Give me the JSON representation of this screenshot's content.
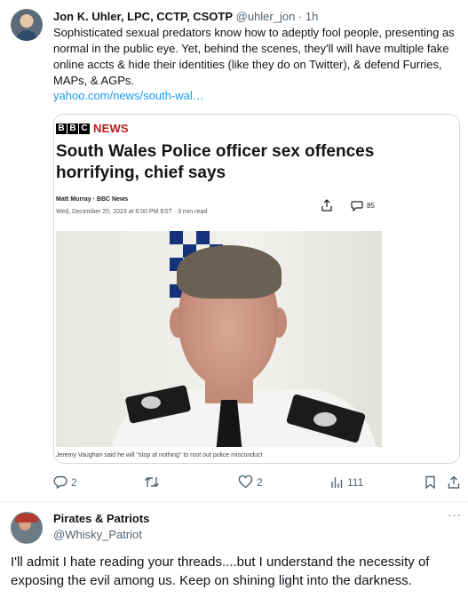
{
  "tweet1": {
    "author_name": "Jon K. Uhler, LPC, CCTP, CSOTP",
    "handle": "@uhler_jon",
    "separator": "·",
    "time": "1h",
    "text": "Sophisticated sexual predators know how to adeptly fool people, presenting as normal in the public eye. Yet, behind the scenes, they'll will have multiple fake online accts & hide their identities (like they do on Twitter), & defend Furries, MAPs, & AGPs.",
    "link": "yahoo.com/news/south-wal…",
    "card": {
      "logo_letters": [
        "B",
        "B",
        "C"
      ],
      "logo_news": "NEWS",
      "headline": "South Wales Police officer sex offences horrifying, chief says",
      "byline": "Matt Murray · BBC News",
      "dateline": "Wed, December 20, 2023 at 6:00 PM EST · 3 min read",
      "comment_count": "85",
      "caption": "Jeremy Vaughan said he will \"stop at nothing\" to root out police misconduct"
    },
    "actions": {
      "replies": "2",
      "retweets": "",
      "likes": "2",
      "views": "111"
    }
  },
  "tweet2": {
    "author_name": "Pirates & Patriots",
    "handle": "@Whisky_Patriot",
    "more": "···",
    "text": "I'll admit I hate reading your threads....but I understand the necessity of exposing the evil among us.  Keep on shining light into the darkness."
  },
  "colors": {
    "accent": "#1d9bf0",
    "muted": "#536471",
    "bbc_red": "#bb1919"
  }
}
